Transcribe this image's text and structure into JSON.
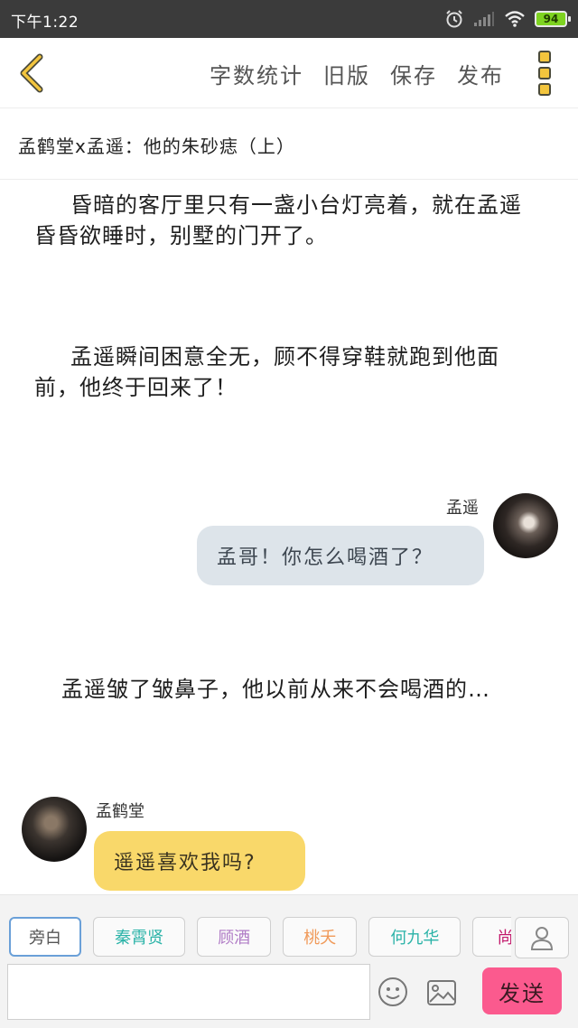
{
  "status_bar": {
    "time": "下午1:22",
    "battery": "94",
    "battery_color": "#7ed321",
    "icons": [
      "alarm-icon",
      "signal-icon",
      "wifi-icon",
      "battery-icon"
    ]
  },
  "toolbar": {
    "back_icon": "chevron-left-icon",
    "word_count": "字数统计",
    "old_version": "旧版",
    "save": "保存",
    "publish": "发布",
    "more_icon": "more-vertical-icon",
    "accent": "#f3c53d"
  },
  "story": {
    "title": "孟鹤堂x孟遥：他的朱砂痣（上）",
    "messages": [
      {
        "type": "narration",
        "text": "昏暗的客厅里只有一盏小台灯亮着，就在孟遥昏昏欲睡时，别墅的门开了。"
      },
      {
        "type": "narration",
        "text": "孟遥瞬间困意全无，顾不得穿鞋就跑到他面前，他终于回来了！"
      },
      {
        "type": "dialogue",
        "side": "right",
        "speaker": "孟遥",
        "text": "孟哥！你怎么喝酒了？",
        "bubble_color": "#dde4ea"
      },
      {
        "type": "narration",
        "text": "孟遥皱了皱鼻子，他以前从来不会喝酒的…"
      },
      {
        "type": "dialogue",
        "side": "left",
        "speaker": "孟鹤堂",
        "text": "遥遥喜欢我吗?",
        "bubble_color": "#f9d86a"
      }
    ]
  },
  "composer": {
    "characters": [
      {
        "label": "旁白",
        "color": "#555555",
        "active": true
      },
      {
        "label": "秦霄贤",
        "color": "#2bb3a8",
        "active": false
      },
      {
        "label": "顾酒",
        "color": "#b07cc6",
        "active": false
      },
      {
        "label": "桃夭",
        "color": "#f09a5a",
        "active": false
      },
      {
        "label": "何九华",
        "color": "#2bb3a8",
        "active": false
      },
      {
        "label": "尚九",
        "color": "#c2186b",
        "active": false
      }
    ],
    "user_icon": "user-icon",
    "input_placeholder": "",
    "emoji_icon": "smiley-icon",
    "image_icon": "image-icon",
    "send": "发送",
    "send_color": "#fb5a8e"
  }
}
